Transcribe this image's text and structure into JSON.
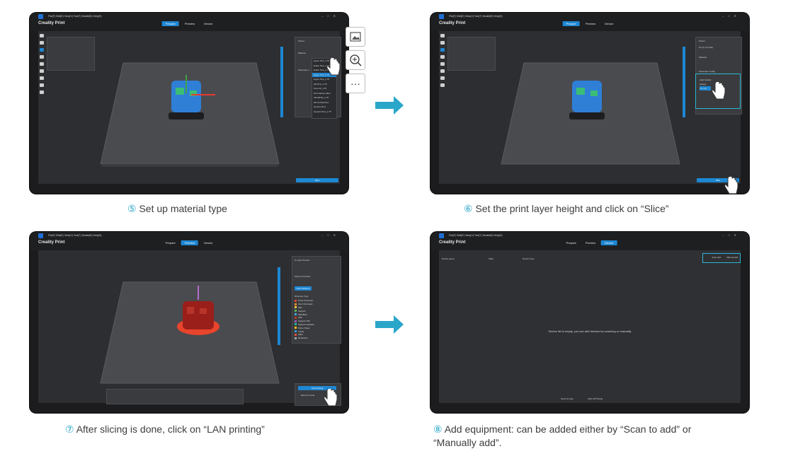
{
  "app": {
    "title": "Creality Print",
    "menu": "File(F)   Edit(E)   View(V)   Tool(T)   Model(M)   Help(H)",
    "tabs": [
      "Prepare",
      "Preview",
      "Device"
    ]
  },
  "steps": [
    {
      "number": "⑤",
      "caption": "Set up material type",
      "active_tab": 0
    },
    {
      "number": "⑥",
      "caption": "Set the print layer height and click on “Slice”",
      "active_tab": 0
    },
    {
      "number": "⑦",
      "caption": "After slicing is done, click on “LAN printing”",
      "active_tab": 1
    },
    {
      "number": "⑧",
      "caption_line1": "Add equipment: can be added either by “Scan to add” or",
      "caption_line2": "“Manually add”.",
      "active_tab": 2
    }
  ],
  "shot1": {
    "panel_printer": "Printer",
    "panel_material": "Material",
    "panel_param": "Parameter c",
    "materials": [
      "Hyper PLA_1.75",
      "Ender PLA_1.75",
      "Ender PLA_1.75",
      "Hyper PLA_1.75",
      "Hyper PLA_1.75",
      "CR-PLA_1.75",
      "PLA-CF_1.75",
      "PLA Carbon Fiber",
      "CR-PETG_1.75",
      "HP-ULTRA PLA",
      "Generic PLA",
      "Generic PLA_1.75"
    ],
    "slice": "Slice"
  },
  "shot2": {
    "panel_printer": "Printer",
    "printer_value": "K1 (0.4 nozzle)",
    "panel_material": "Material",
    "panel_param": "Parameter config",
    "params": [
      "High Quality",
      "Quality",
      "Normal"
    ],
    "slice": "Slice"
  },
  "shot3": {
    "gcode_title": "G-code Preview",
    "show_title": "Show in Preview",
    "color_scheme": "Color Scheme",
    "legend_title": "Structure Type",
    "legend": [
      "Outer Perimeter",
      "Inner Perimeter",
      "Skin",
      "Support",
      "Skirt/Brim",
      "Infill",
      "Support infill",
      "Support interface",
      "Prime Tower",
      "Travel",
      "Wipe",
      "Retraction"
    ],
    "legend_colors": [
      "#e8452c",
      "#f08a24",
      "#f4c542",
      "#59b55e",
      "#4aa8e0",
      "#c0392b",
      "#9b59b6",
      "#1abc9c",
      "#f1c40f",
      "#3498db",
      "#e74c3c",
      "#95a5a6"
    ],
    "lan_button": "LAN printing",
    "export_button": "Export G-code"
  },
  "shot4": {
    "filter_group": "Device group",
    "filter_state": "State",
    "filter_type": "Device Type",
    "scan_add": "Scan add",
    "manual_add": "Manual add",
    "empty_message": "Device list is empty, you can add devices by scanning or manually",
    "bottom_btn1": "Send G-code",
    "bottom_btn2": "Start all Printing"
  }
}
